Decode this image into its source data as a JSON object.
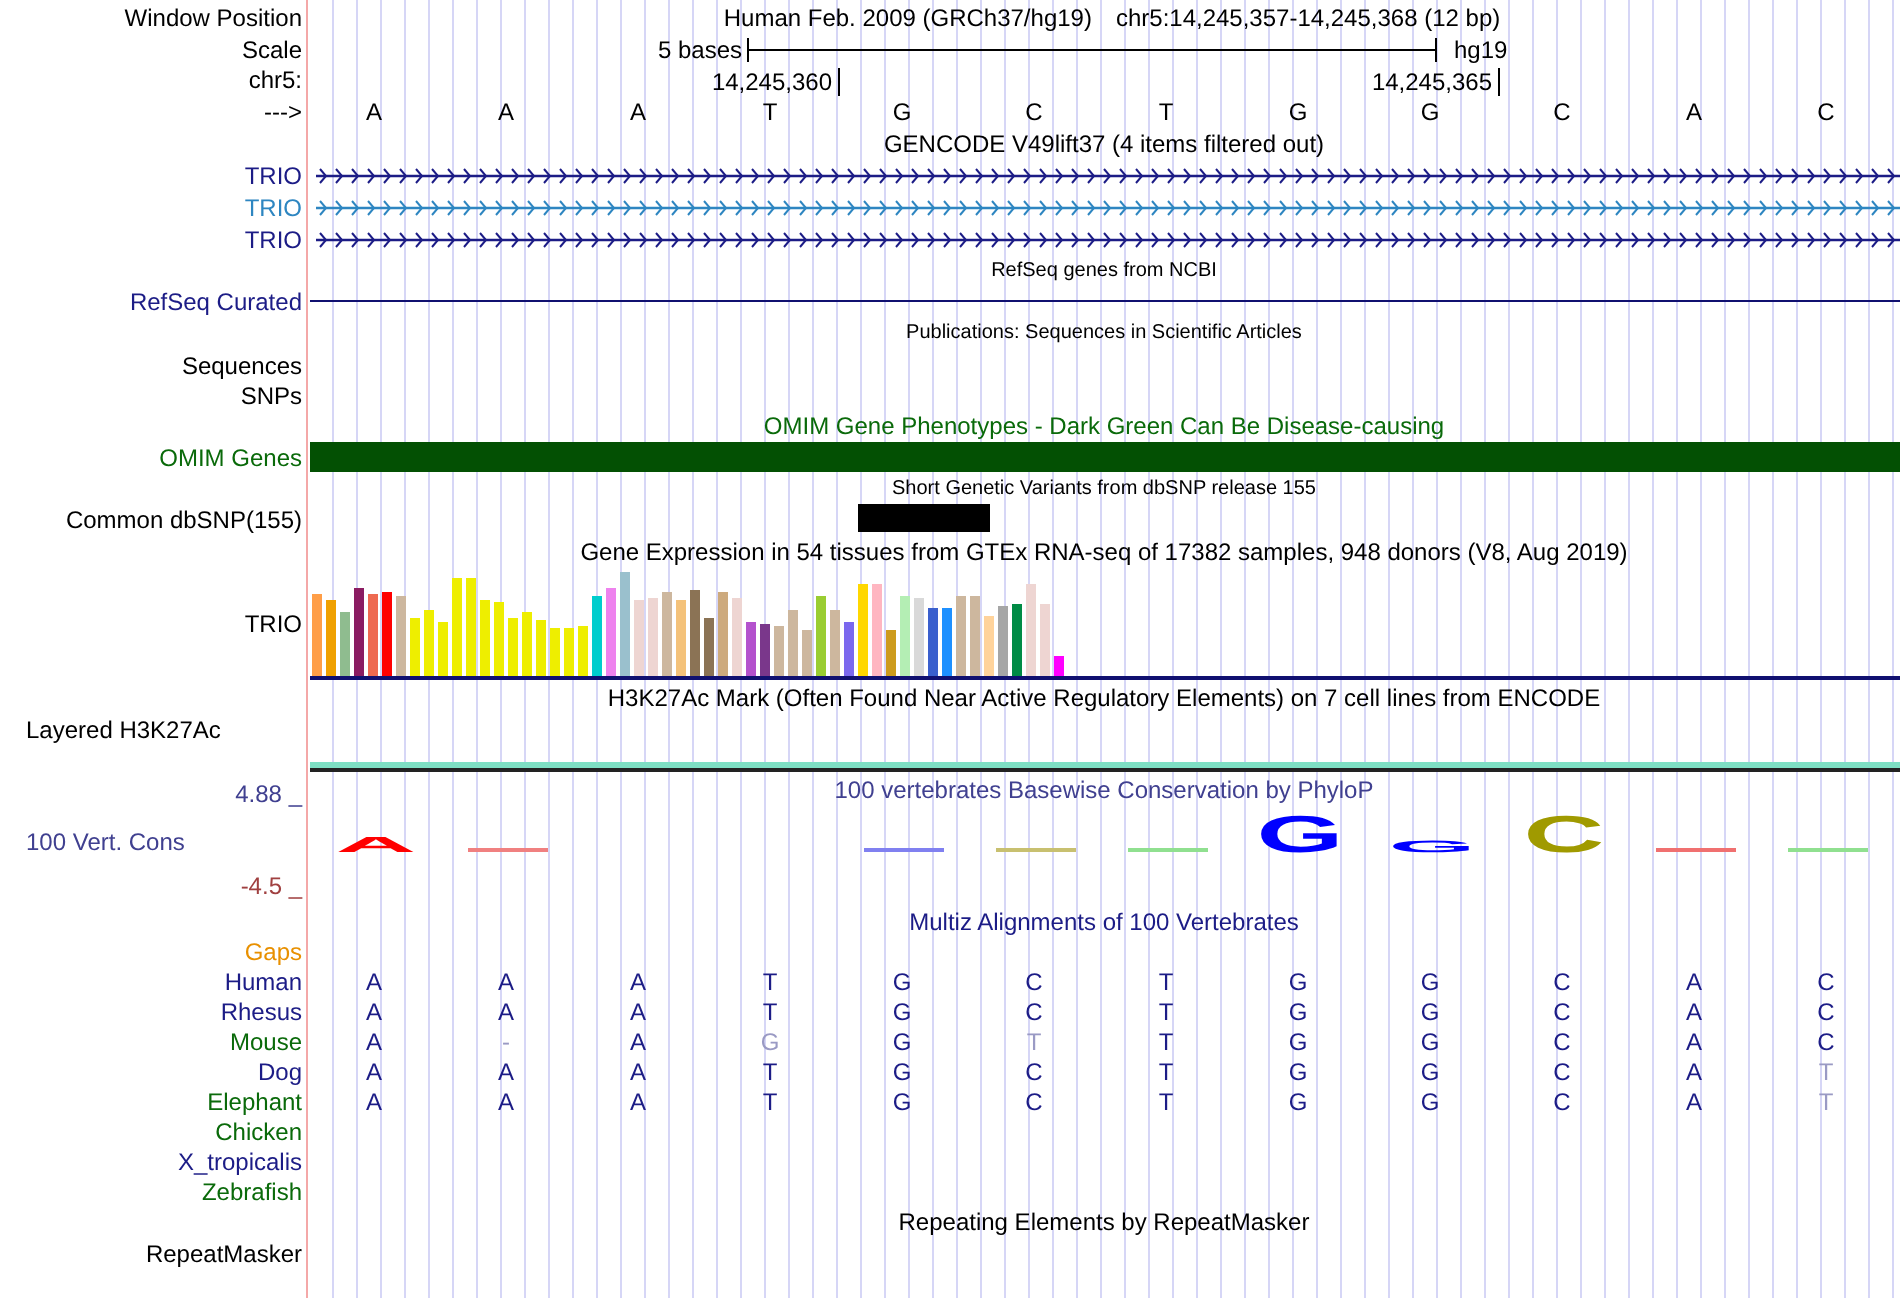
{
  "header": {
    "window_position_label": "Window Position",
    "scale_label": "Scale",
    "chrom_label": "chr5:",
    "strand_label": "--->",
    "assembly": "Human Feb. 2009 (GRCh37/hg19)",
    "position": "chr5:14,245,357-14,245,368 (12 bp)",
    "scale_text": "5 bases",
    "scale_db": "hg19",
    "tick_labels": [
      "14,245,360",
      "14,245,365"
    ],
    "bases": [
      "A",
      "A",
      "A",
      "T",
      "G",
      "C",
      "T",
      "G",
      "G",
      "C",
      "A",
      "C"
    ]
  },
  "gencode": {
    "title": "GENCODE V49lift37 (4 items filtered out)",
    "transcripts": [
      {
        "label": "TRIO",
        "color": "#1c1c86"
      },
      {
        "label": "TRIO",
        "color": "#2e86c1"
      },
      {
        "label": "TRIO",
        "color": "#1c1c86"
      }
    ]
  },
  "refseq": {
    "title": "RefSeq genes from NCBI",
    "label": "RefSeq Curated"
  },
  "publications": {
    "title": "Publications: Sequences in Scientific Articles",
    "labels": [
      "Sequences",
      "SNPs"
    ]
  },
  "omim": {
    "title": "OMIM Gene Phenotypes - Dark Green Can Be Disease-causing",
    "label": "OMIM Genes"
  },
  "dbsnp": {
    "title": "Short Genetic Variants from dbSNP release 155",
    "label": "Common dbSNP(155)"
  },
  "gtex": {
    "title": "Gene Expression in 54 tissues from GTEx RNA-seq of 17382 samples, 948 donors (V8, Aug 2019)",
    "label": "TRIO"
  },
  "h3k27ac": {
    "title": "H3K27Ac Mark (Often Found Near Active Regulatory Elements) on 7 cell lines from ENCODE",
    "label": "Layered H3K27Ac"
  },
  "phylop": {
    "title": "100 vertebrates Basewise Conservation by PhyloP",
    "label": "100 Vert. Cons",
    "max": "4.88 _",
    "min": "-4.5 _",
    "logo": [
      {
        "kind": "mid",
        "letter": "A",
        "color": "#ff0000"
      },
      {
        "kind": "bar",
        "color": "#f08080"
      },
      {
        "kind": "empty"
      },
      {
        "kind": "empty"
      },
      {
        "kind": "bar",
        "color": "#8080f0"
      },
      {
        "kind": "bar",
        "color": "#c8c070"
      },
      {
        "kind": "bar",
        "color": "#90e090"
      },
      {
        "kind": "tall",
        "letter": "G",
        "color": "#0000ff"
      },
      {
        "kind": "short",
        "letter": "G",
        "color": "#0000ff"
      },
      {
        "kind": "tall",
        "letter": "C",
        "color": "#a09a00"
      },
      {
        "kind": "bar",
        "color": "#f07070"
      },
      {
        "kind": "bar",
        "color": "#90e090"
      }
    ]
  },
  "multiz": {
    "title": "Multiz Alignments of 100 Vertebrates",
    "gaps_label": "Gaps",
    "species": [
      {
        "name": "Human",
        "color": "#1c1c86",
        "bases": [
          {
            "base": "A",
            "mismatch": false
          },
          {
            "base": "A",
            "mismatch": false
          },
          {
            "base": "A",
            "mismatch": false
          },
          {
            "base": "T",
            "mismatch": false
          },
          {
            "base": "G",
            "mismatch": false
          },
          {
            "base": "C",
            "mismatch": false
          },
          {
            "base": "T",
            "mismatch": false
          },
          {
            "base": "G",
            "mismatch": false
          },
          {
            "base": "G",
            "mismatch": false
          },
          {
            "base": "C",
            "mismatch": false
          },
          {
            "base": "A",
            "mismatch": false
          },
          {
            "base": "C",
            "mismatch": false
          }
        ]
      },
      {
        "name": "Rhesus",
        "color": "#1c1c86",
        "bases": [
          {
            "base": "A",
            "mismatch": false
          },
          {
            "base": "A",
            "mismatch": false
          },
          {
            "base": "A",
            "mismatch": false
          },
          {
            "base": "T",
            "mismatch": false
          },
          {
            "base": "G",
            "mismatch": false
          },
          {
            "base": "C",
            "mismatch": false
          },
          {
            "base": "T",
            "mismatch": false
          },
          {
            "base": "G",
            "mismatch": false
          },
          {
            "base": "G",
            "mismatch": false
          },
          {
            "base": "C",
            "mismatch": false
          },
          {
            "base": "A",
            "mismatch": false
          },
          {
            "base": "C",
            "mismatch": false
          }
        ]
      },
      {
        "name": "Mouse",
        "color": "#0a6a0a",
        "bases": [
          {
            "base": "A",
            "mismatch": false
          },
          {
            "base": "-",
            "mismatch": true
          },
          {
            "base": "A",
            "mismatch": false
          },
          {
            "base": "G",
            "mismatch": true
          },
          {
            "base": "G",
            "mismatch": false
          },
          {
            "base": "T",
            "mismatch": true
          },
          {
            "base": "T",
            "mismatch": false
          },
          {
            "base": "G",
            "mismatch": false
          },
          {
            "base": "G",
            "mismatch": false
          },
          {
            "base": "C",
            "mismatch": false
          },
          {
            "base": "A",
            "mismatch": false
          },
          {
            "base": "C",
            "mismatch": false
          }
        ]
      },
      {
        "name": "Dog",
        "color": "#1c1c86",
        "bases": [
          {
            "base": "A",
            "mismatch": false
          },
          {
            "base": "A",
            "mismatch": false
          },
          {
            "base": "A",
            "mismatch": false
          },
          {
            "base": "T",
            "mismatch": false
          },
          {
            "base": "G",
            "mismatch": false
          },
          {
            "base": "C",
            "mismatch": false
          },
          {
            "base": "T",
            "mismatch": false
          },
          {
            "base": "G",
            "mismatch": false
          },
          {
            "base": "G",
            "mismatch": false
          },
          {
            "base": "C",
            "mismatch": false
          },
          {
            "base": "A",
            "mismatch": false
          },
          {
            "base": "T",
            "mismatch": true
          }
        ]
      },
      {
        "name": "Elephant",
        "color": "#0a6a0a",
        "bases": [
          {
            "base": "A",
            "mismatch": false
          },
          {
            "base": "A",
            "mismatch": false
          },
          {
            "base": "A",
            "mismatch": false
          },
          {
            "base": "T",
            "mismatch": false
          },
          {
            "base": "G",
            "mismatch": false
          },
          {
            "base": "C",
            "mismatch": false
          },
          {
            "base": "T",
            "mismatch": false
          },
          {
            "base": "G",
            "mismatch": false
          },
          {
            "base": "G",
            "mismatch": false
          },
          {
            "base": "C",
            "mismatch": false
          },
          {
            "base": "A",
            "mismatch": false
          },
          {
            "base": "T",
            "mismatch": true
          }
        ]
      },
      {
        "name": "Chicken",
        "color": "#0a6a0a"
      },
      {
        "name": "X_tropicalis",
        "color": "#1c1c86"
      },
      {
        "name": "Zebrafish",
        "color": "#0a6a0a"
      }
    ]
  },
  "repeatmasker": {
    "title": "Repeating Elements by RepeatMasker",
    "label": "RepeatMasker"
  }
}
